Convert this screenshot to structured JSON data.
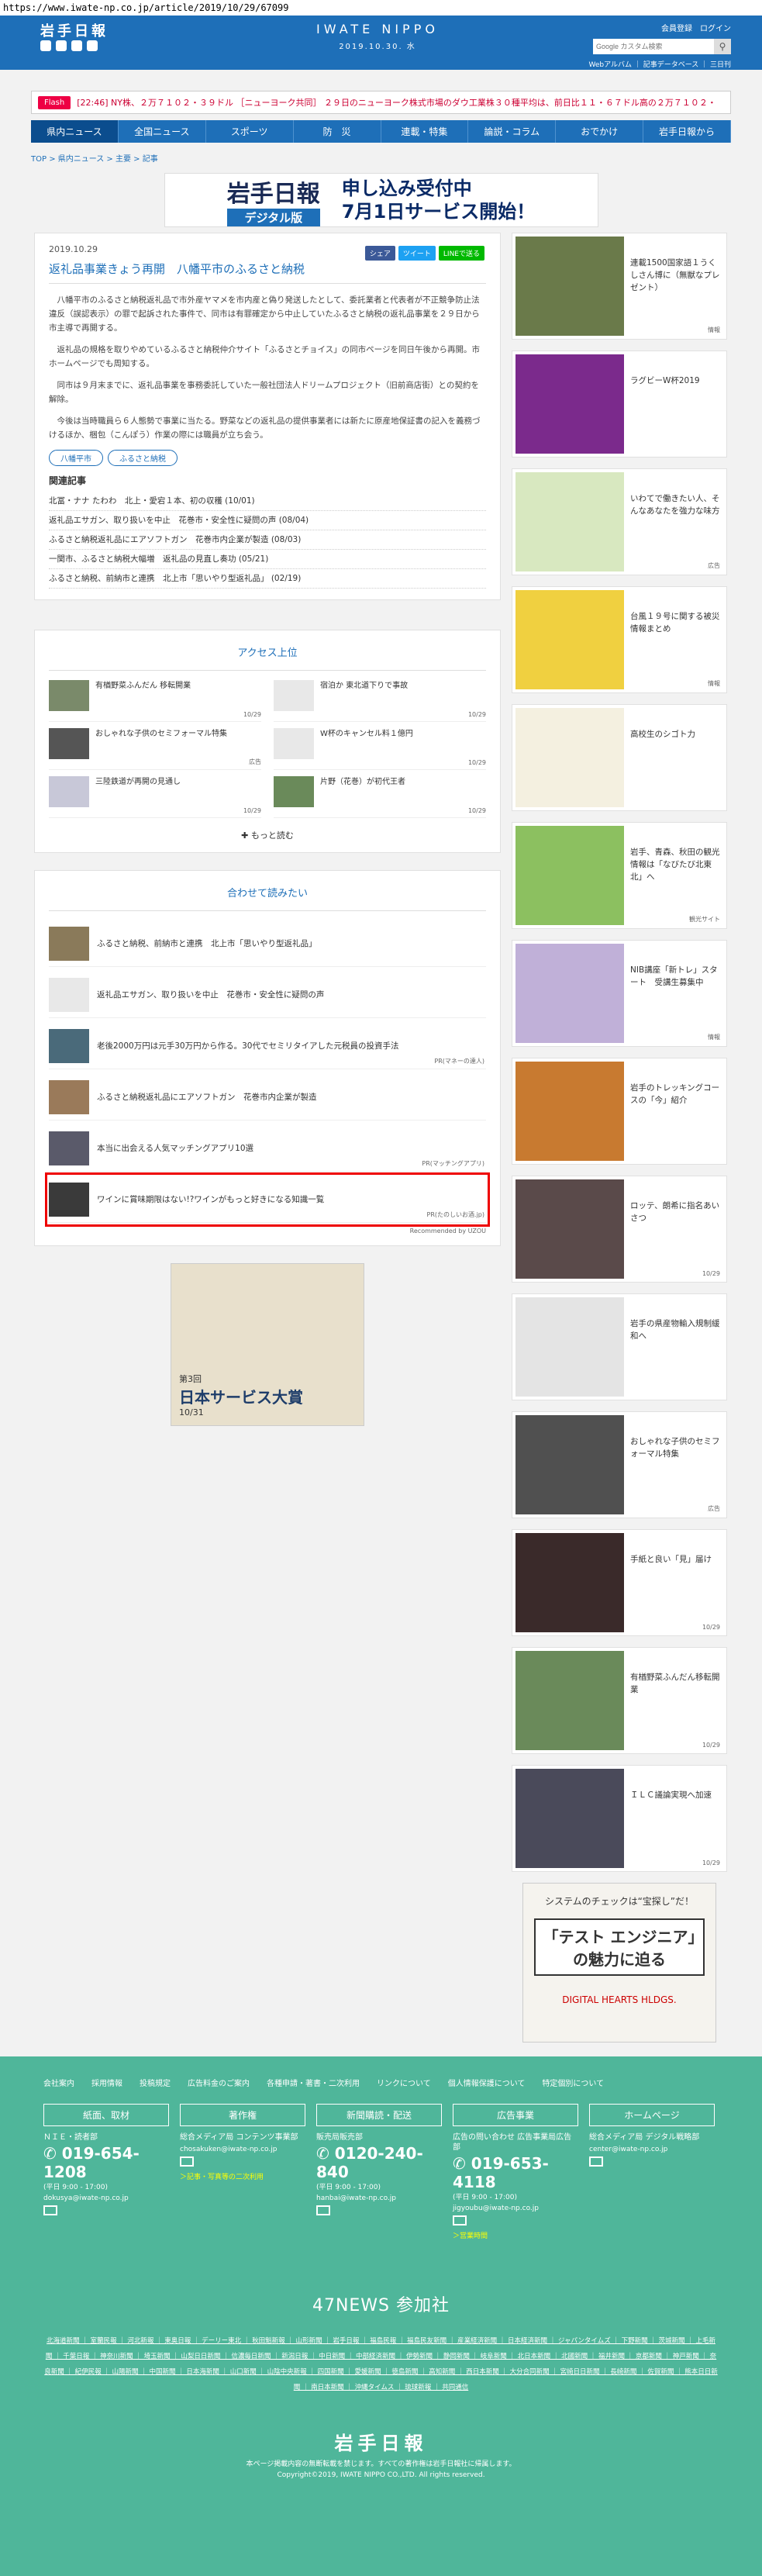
{
  "browser": {
    "url": "https://www.iwate-np.co.jp/article/2019/10/29/67099"
  },
  "header": {
    "logo": "岩手日報",
    "brand": "IWATE NIPPO",
    "date": "2019.10.30. 水",
    "register": "会員登録",
    "login": "ログイン",
    "search_placeholder": "Google カスタム検索",
    "links": "Webアルバム ｜ 記事データベース ｜ 三日刊",
    "colors": {
      "primary": "#1e6fb8",
      "footer": "#4fb69a",
      "highlight": "#e00000"
    }
  },
  "ticker": {
    "badge": "Flash",
    "text": "[22:46] NY株、２万７１０２・３９ドル ［ニューヨーク共同］ ２９日のニューヨーク株式市場のダウ工業株３０種平均は、前日比１１・６７ドル高の２万７１０２・"
  },
  "nav": [
    "県内ニュース",
    "全国ニュース",
    "スポーツ",
    "防　災",
    "連載・特集",
    "論説・コラム",
    "おでかけ",
    "岩手日報から"
  ],
  "breadcrumb": "TOP > 県内ニュース > 主要 > 記事",
  "banner": {
    "left": "岩手日報",
    "left_sub": "デジタル版",
    "right1": "申し込み受付中",
    "right2": "7月1日サービス開始！"
  },
  "article": {
    "date": "2019.10.29",
    "share": [
      "シェア",
      "ツイート",
      "LINEで送る"
    ],
    "title": "返礼品事業きょう再開　八幡平市のふるさと納税",
    "paragraphs": [
      "八幡平市のふるさと納税返礼品で市外産ヤマメを市内産と偽り発送したとして、委託業者と代表者が不正競争防止法違反（誤認表示）の罪で起訴された事件で、同市は有罪確定から中止していたふるさと納税の返礼品事業を２９日から市主導で再開する。",
      "返礼品の規格を取りやめているふるさと納税仲介サイト「ふるさとチョイス」の同市ページを同日午後から再開。市ホームページでも周知する。",
      "同市は９月末までに、返礼品事業を事務委託していた一般社団法人ドリームプロジェクト（旧前商店街）との契約を解除。",
      "今後は当時職員ら６人態勢で事業に当たる。野菜などの返礼品の提供事業者には新たに原産地保証書の記入を義務づけるほか、梱包（こんぽう）作業の際には職員が立ち会う。"
    ],
    "tags": [
      "八幡平市",
      "ふるさと納税"
    ],
    "related_title": "関連記事",
    "related": [
      "北冨・ナナ たわわ　北上・愛宕１本、初の収穫 (10/01)",
      "返礼品エサガン、取り扱いを中止　花巻市・安全性に疑問の声 (08/04)",
      "ふるさと納税返礼品にエアソフトガン　花巻市内企業が製造 (08/03)",
      "一関市、ふるさと納税大幅増　返礼品の見直し奏功 (05/21)",
      "ふるさと納税、前納市と連携　北上市「思いやり型返礼品」 (02/19)"
    ]
  },
  "access": {
    "title": "アクセス上位",
    "items": [
      {
        "t": "有楢野菜ふんだん 移転開業",
        "d": "10/29"
      },
      {
        "t": "宿泊か 東北道下りで事故",
        "d": "10/29"
      },
      {
        "t": "おしゃれな子供のセミフォーマル特集",
        "d": "広告"
      },
      {
        "t": "W杯のキャンセル料１億円",
        "d": "10/29"
      },
      {
        "t": "三陸鉄道が再開の見通し",
        "d": "10/29"
      },
      {
        "t": "片野（花巻）が初代王者",
        "d": "10/29"
      }
    ],
    "more": "もっと読む"
  },
  "recommend": {
    "title": "合わせて読みたい",
    "items": [
      {
        "t": "ふるさと納税、前納市と連携　北上市「思いやり型返礼品」",
        "p": ""
      },
      {
        "t": "返礼品エサガン、取り扱いを中止　花巻市・安全性に疑問の声",
        "p": ""
      },
      {
        "t": "老後2000万円は元手30万円から作る。30代でセミリタイアした元税員の投資手法",
        "p": "PR(マネーの達人)"
      },
      {
        "t": "ふるさと納税返礼品にエアソフトガン　花巻市内企業が製造",
        "p": ""
      },
      {
        "t": "本当に出会える人気マッチングアプリ10選",
        "p": "PR(マッチングアプリ)"
      },
      {
        "t": "ワインに賞味期限はない!?ワインがもっと好きになる知識一覧",
        "p": "PR(たのしいお酒.jp)"
      }
    ],
    "powered": "Recommended by UZOU"
  },
  "ad_main": {
    "title": "日本サービス大賞",
    "sub": "第3回",
    "deadline": "10/31"
  },
  "sidebar": [
    {
      "t": "連載1500国家語１うくしさん博に（無獣なプレゼント）",
      "d": "情報"
    },
    {
      "t": "ラグビーW杯2019",
      "d": ""
    },
    {
      "t": "いわてで働きたい人、そんなあなたを強力な味方",
      "d": "広告"
    },
    {
      "t": "台風１９号に関する被災情報まとめ",
      "d": "情報"
    },
    {
      "t": "高校生のシゴト力",
      "d": ""
    },
    {
      "t": "岩手、青森、秋田の観光情報は「なびたび北東北」へ",
      "d": "観光サイト"
    },
    {
      "t": "NIB講座「新トレ」スタート　受講生募集中",
      "d": "情報"
    },
    {
      "t": "岩手のトレッキングコースの「今」紹介",
      "d": ""
    },
    {
      "t": "ロッテ、朗希に指名あいさつ",
      "d": "10/29"
    },
    {
      "t": "岩手の県産物輸入規制緩和へ",
      "d": ""
    },
    {
      "t": "おしゃれな子供のセミフォーマル特集",
      "d": "広告"
    },
    {
      "t": "手紙と良い「見」届け",
      "d": "10/29"
    },
    {
      "t": "有楢野菜ふんだん移転開業",
      "d": "10/29"
    },
    {
      "t": "ＩＬＣ議論実現へ加速",
      "d": "10/29"
    }
  ],
  "side_ad": {
    "top": "システムのチェックは“宝探し”だ！",
    "main": "「テスト エンジニア」の魅力に迫る",
    "brand": "DIGITAL HEARTS HLDGS."
  },
  "footer": {
    "links": [
      "会社案内",
      "採用情報",
      "投稿規定",
      "広告料金のご案内",
      "各種申請・著書・二次利用",
      "リンクについて",
      "個人情報保護について",
      "特定個別について"
    ],
    "cols": [
      {
        "h": "紙面、取材",
        "l": "ＮＩＥ・読者部",
        "p": "019-654-1208",
        "hr": "(平日 9:00 - 17:00)",
        "e": "dokusya@iwate-np.co.jp",
        "y": ""
      },
      {
        "h": "著作権",
        "l": "総合メディア局 コンテンツ事業部",
        "p": "",
        "hr": "",
        "e": "chosakuken@iwate-np.co.jp",
        "y": "＞記事・写真等の二次利用"
      },
      {
        "h": "新聞購読・配送",
        "l": "販売局販売部",
        "p": "0120-240-840",
        "hr": "(平日 9:00 - 17:00)",
        "e": "hanbai@iwate-np.co.jp",
        "y": ""
      },
      {
        "h": "広告事業",
        "l": "広告の問い合わせ 広告事業局広告部",
        "p": "019-653-4118",
        "hr": "(平日 9:00 - 17:00)",
        "e": "jigyoubu@iwate-np.co.jp",
        "y": "＞営業時間"
      },
      {
        "h": "ホームページ",
        "l": "総合メディア局 デジタル戦略部",
        "p": "",
        "hr": "",
        "e": "center@iwate-np.co.jp",
        "y": ""
      }
    ],
    "n47": "47NEWS 参加社",
    "papers": "北海道新聞 ｜ 室蘭民報 ｜ 河北新報 ｜ 東奥日報 ｜ デーリー東北 ｜ 秋田魁新報 ｜ 山形新聞 ｜ 岩手日報 ｜ 福島民報 ｜ 福島民友新聞 ｜ 産業経済新聞 ｜ 日本経済新聞 ｜ ジャパンタイムズ ｜ 下野新聞 ｜ 茨城新聞 ｜ 上毛新聞 ｜ 千葉日報 ｜ 神奈川新聞 ｜ 埼玉新聞 ｜ 山梨日日新聞 ｜ 信濃毎日新聞 ｜ 新潟日報 ｜ 中日新聞 ｜ 中部経済新聞 ｜ 伊勢新聞 ｜ 静岡新聞 ｜ 岐阜新聞 ｜ 北日本新聞 ｜ 北國新聞 ｜ 福井新聞 ｜ 京都新聞 ｜ 神戸新聞 ｜ 奈良新聞 ｜ 紀伊民報 ｜ 山陽新聞 ｜ 中国新聞 ｜ 日本海新聞 ｜ 山口新聞 ｜ 山陰中央新報 ｜ 四国新聞 ｜ 愛媛新聞 ｜ 徳島新聞 ｜ 高知新聞 ｜ 西日本新聞 ｜ 大分合同新聞 ｜ 宮崎日日新聞 ｜ 長崎新聞 ｜ 佐賀新聞 ｜ 熊本日日新聞 ｜ 南日本新聞 ｜ 沖縄タイムス ｜ 琉球新報 ｜ 共同通信",
    "logo": "岩手日報",
    "note": "本ページ掲載内容の無断転載を禁じます。すべての著作権は岩手日報社に帰属します。",
    "copy": "Copyright©2019, IWATE NIPPO CO.,LTD. All rights reserved."
  }
}
